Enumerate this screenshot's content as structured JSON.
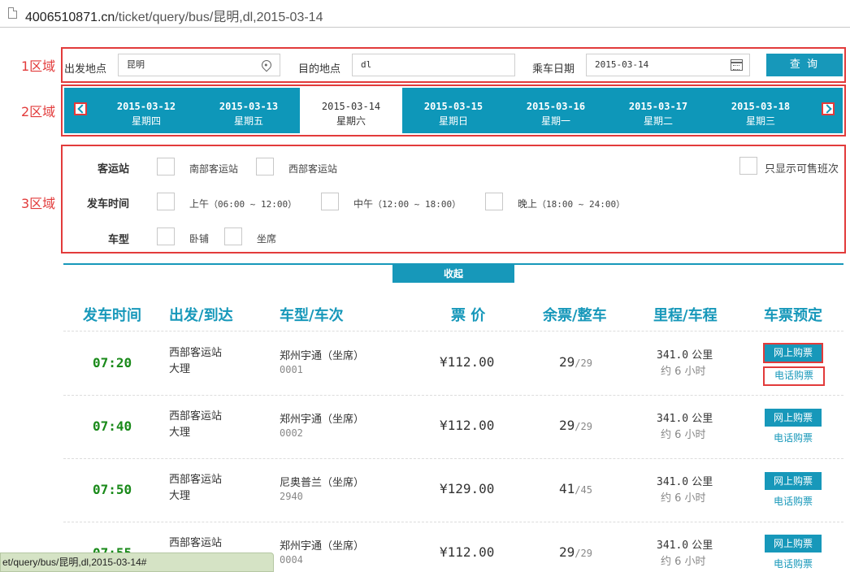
{
  "browser": {
    "url_host": "4006510871.cn",
    "url_path": "/ticket/query/bus/昆明,dl,2015-03-14",
    "status_text": "et/query/bus/昆明,dl,2015-03-14#"
  },
  "annotations": {
    "zone1": "1区域",
    "zone2": "2区域",
    "zone3": "3区域"
  },
  "search": {
    "from_label": "出发地点",
    "from_value": "昆明",
    "to_label": "目的地点",
    "to_value": "dl",
    "date_label": "乘车日期",
    "date_value": "2015-03-14",
    "query_button": "查 询"
  },
  "dates": [
    {
      "date": "2015-03-12",
      "weekday": "星期四",
      "active": false
    },
    {
      "date": "2015-03-13",
      "weekday": "星期五",
      "active": false
    },
    {
      "date": "2015-03-14",
      "weekday": "星期六",
      "active": true
    },
    {
      "date": "2015-03-15",
      "weekday": "星期日",
      "active": false
    },
    {
      "date": "2015-03-16",
      "weekday": "星期一",
      "active": false
    },
    {
      "date": "2015-03-17",
      "weekday": "星期二",
      "active": false
    },
    {
      "date": "2015-03-18",
      "weekday": "星期三",
      "active": false
    }
  ],
  "filters": {
    "station_title": "客运站",
    "stations": [
      "南部客运站",
      "西部客运站"
    ],
    "only_available": "只显示可售班次",
    "time_title": "发车时间",
    "times": [
      {
        "name": "上午",
        "range": "（06:00 ~ 12:00）"
      },
      {
        "name": "中午",
        "range": "（12:00 ~ 18:00）"
      },
      {
        "name": "晚上",
        "range": "（18:00 ~ 24:00）"
      }
    ],
    "type_title": "车型",
    "types": [
      "卧铺",
      "坐席"
    ]
  },
  "collapse_label": "收起",
  "table": {
    "headers": [
      "发车时间",
      "出发/到达",
      "型/车次",
      "票 价",
      "余票/整车",
      "里程/车程",
      "车票预定"
    ],
    "header_prefix_type": "车",
    "buy_label": "网上购票",
    "phone_label": "电话购票",
    "rows": [
      {
        "time": "07:20",
        "from": "西部客运站",
        "to": "大理",
        "type": "郑州宇通（坐席）",
        "no": "0001",
        "price": "¥112.00",
        "left": "29",
        "total": "/29",
        "dist": "341.0",
        "dist_unit": " 公里",
        "dur": "约 6 小时"
      },
      {
        "time": "07:40",
        "from": "西部客运站",
        "to": "大理",
        "type": "郑州宇通（坐席）",
        "no": "0002",
        "price": "¥112.00",
        "left": "29",
        "total": "/29",
        "dist": "341.0",
        "dist_unit": " 公里",
        "dur": "约 6 小时"
      },
      {
        "time": "07:50",
        "from": "西部客运站",
        "to": "大理",
        "type": "尼奥普兰（坐席）",
        "no": "2940",
        "price": "¥129.00",
        "left": "41",
        "total": "/45",
        "dist": "341.0",
        "dist_unit": " 公里",
        "dur": "约 6 小时"
      },
      {
        "time": "07:55",
        "from": "西部客运站",
        "to": "大理",
        "type": "郑州宇通（坐席）",
        "no": "0004",
        "price": "¥112.00",
        "left": "29",
        "total": "/29",
        "dist": "341.0",
        "dist_unit": " 公里",
        "dur": "约 6 小时"
      }
    ]
  }
}
